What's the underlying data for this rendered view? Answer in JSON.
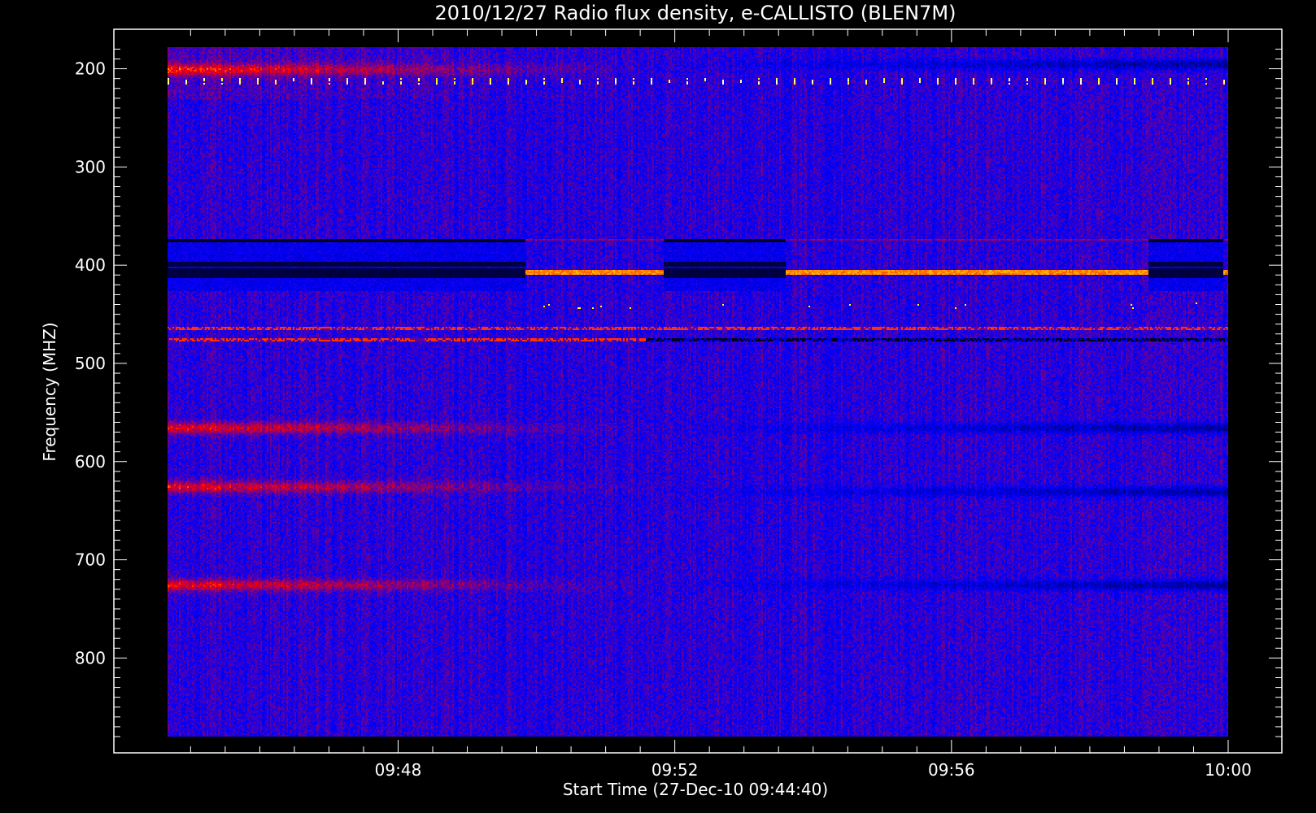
{
  "chart_data": {
    "type": "heatmap",
    "title": "2010/12/27  Radio flux density, e-CALLISTO (BLEN7M)",
    "xlabel": "Start Time (27-Dec-10 09:44:40)",
    "ylabel": "Frequency (MHZ)",
    "x_axis": {
      "range": [
        "09:44:40",
        "10:00:00"
      ],
      "ticks": [
        "09:48",
        "09:52",
        "09:56",
        "10:00"
      ]
    },
    "y_axis": {
      "range": [
        880,
        178
      ],
      "ticks": [
        200,
        300,
        400,
        500,
        600,
        700,
        800
      ],
      "direction": "top-to-bottom increasing"
    },
    "colormap": [
      "#000000",
      "#0000ff",
      "#ff0000",
      "#ffff00",
      "#ffffff"
    ],
    "colors": {
      "background": "#000000",
      "axes": "#ffffff",
      "base_intensity": "#2b1ec8"
    },
    "features": {
      "rfi_dots_freq_mhz": 212,
      "rfi_continuous_lines_mhz": [
        463,
        475
      ],
      "alternating_band_low_mhz": 372,
      "alternating_band_high_mhz": 425,
      "alternating_red_line_mhz": 406,
      "segments_blue_band": [
        [
          "09:44:40",
          "09:49:50"
        ],
        [
          "09:51:50",
          "09:53:35"
        ],
        [
          "09:58:50",
          "09:59:55"
        ]
      ],
      "segments_red_line": [
        [
          "09:49:50",
          "09:51:50"
        ],
        [
          "09:53:35",
          "09:58:50"
        ],
        [
          "09:59:55",
          "10:00:00"
        ]
      ],
      "enhanced_bands_early_mhz": [
        200,
        565,
        625,
        725
      ],
      "dark_bands_late_mhz": [
        195,
        565,
        630,
        725
      ]
    }
  }
}
